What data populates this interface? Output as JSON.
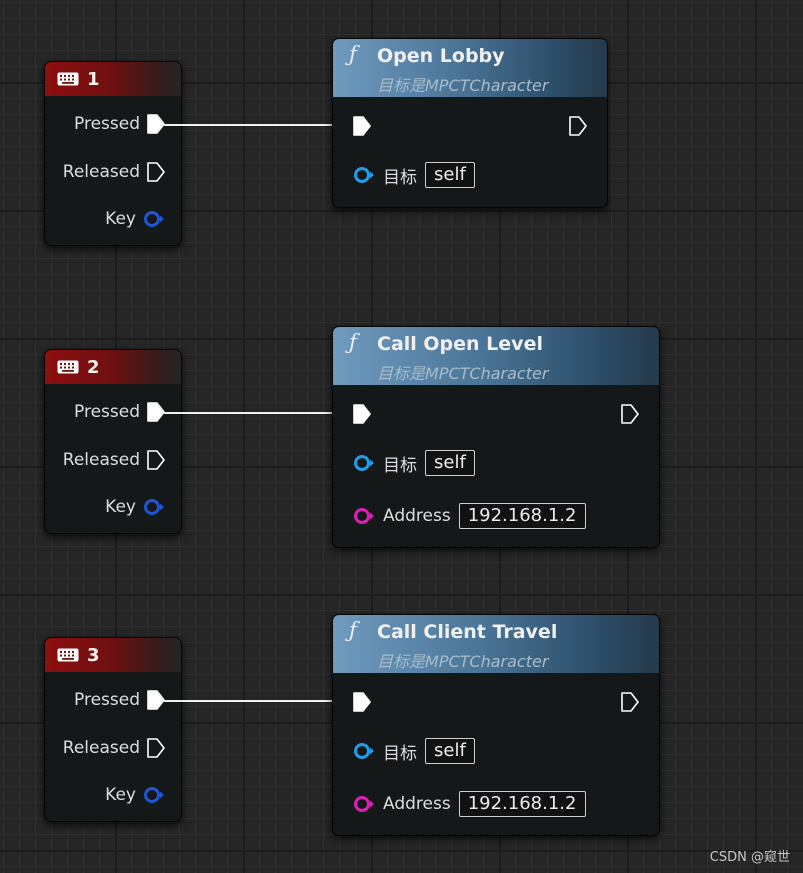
{
  "event_nodes": [
    {
      "key_label": "1",
      "rows": [
        "Pressed",
        "Released",
        "Key"
      ]
    },
    {
      "key_label": "2",
      "rows": [
        "Pressed",
        "Released",
        "Key"
      ]
    },
    {
      "key_label": "3",
      "rows": [
        "Pressed",
        "Released",
        "Key"
      ]
    }
  ],
  "function_nodes": [
    {
      "title": "Open Lobby",
      "subtitle": "目标是MPCTCharacter",
      "target_label": "目标",
      "target_value": "self"
    },
    {
      "title": "Call Open Level",
      "subtitle": "目标是MPCTCharacter",
      "target_label": "目标",
      "target_value": "self",
      "address_label": "Address",
      "address_value": "192.168.1.2"
    },
    {
      "title": "Call Client Travel",
      "subtitle": "目标是MPCTCharacter",
      "target_label": "目标",
      "target_value": "self",
      "address_label": "Address",
      "address_value": "192.168.1.2"
    }
  ],
  "icons": {
    "function": "ƒ",
    "event": "keyboard-icon",
    "exec_pin": "exec-pin-icon",
    "data_pin": "data-pin-icon"
  },
  "colors": {
    "event_header": "#8d0f0f",
    "function_header": "#4b7598",
    "object_pin": "#1fa0e8",
    "key_pin": "#1c56d6",
    "string_pin": "#e01fb8",
    "wire": "#f0f0f0"
  },
  "watermark": "CSDN @窥世"
}
